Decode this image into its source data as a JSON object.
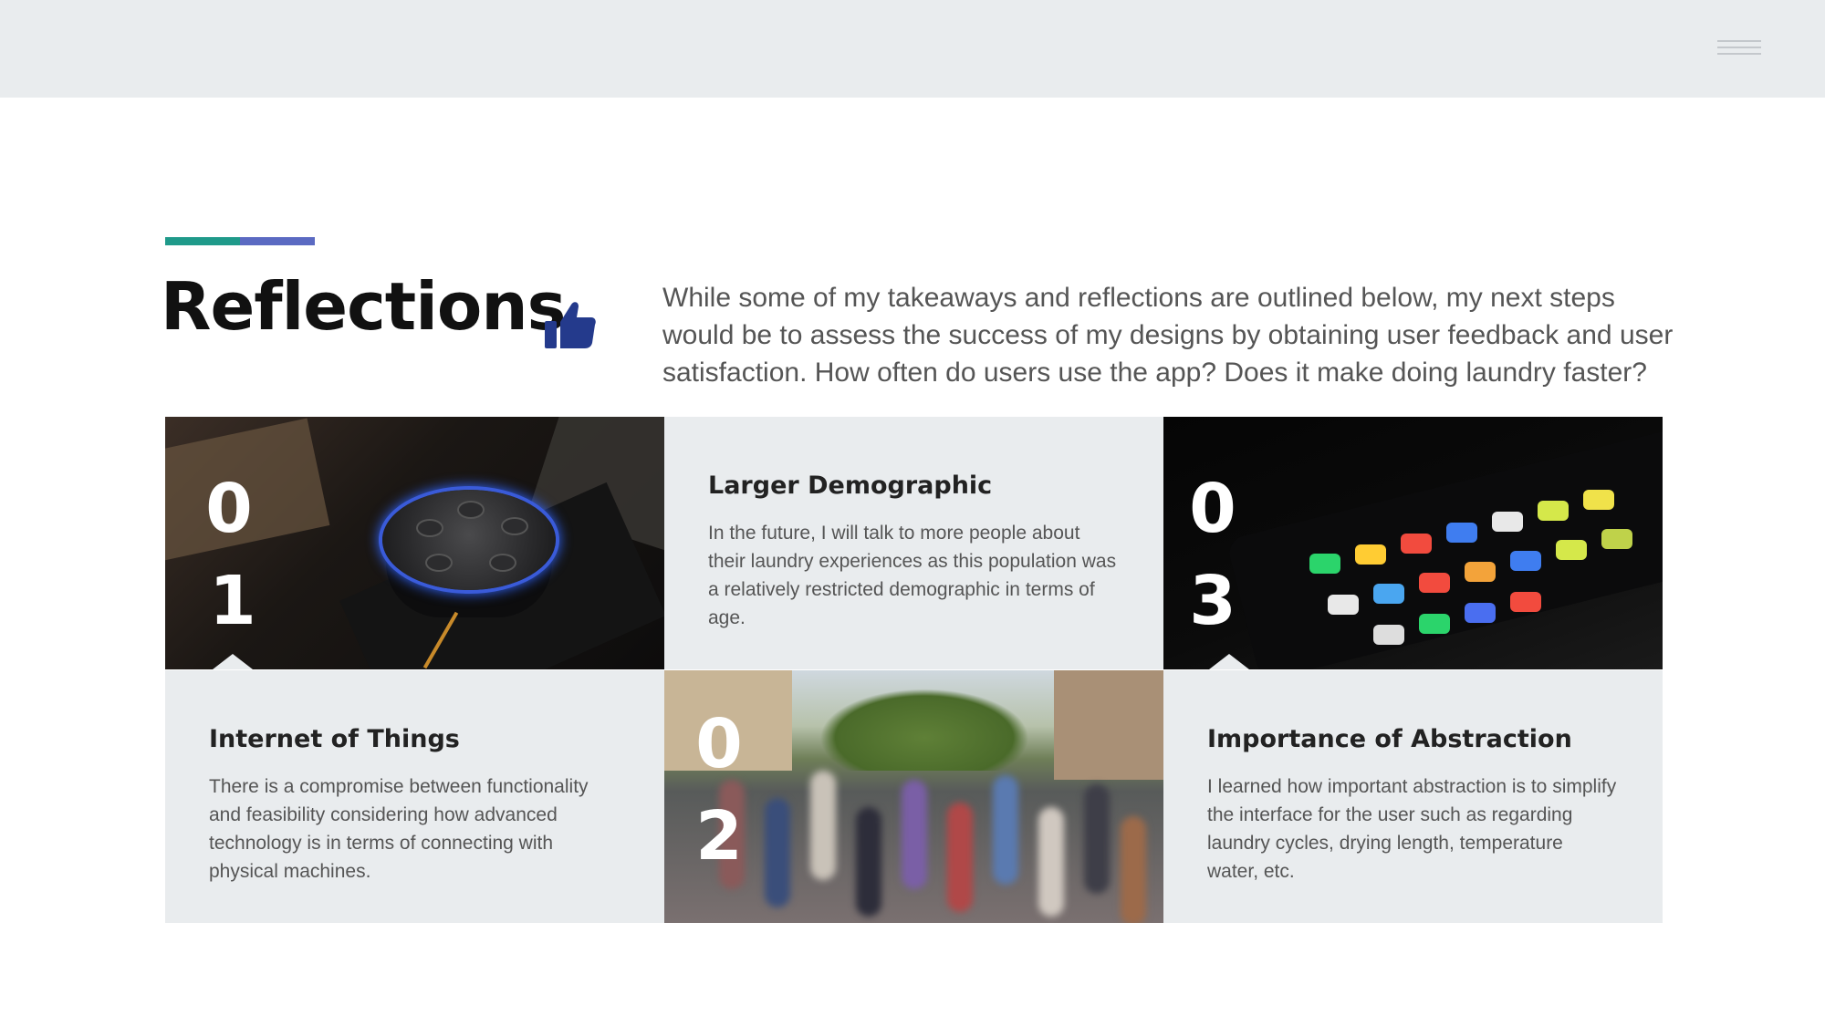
{
  "header": {
    "menu_icon": "hamburger-menu-icon"
  },
  "accent_colors": [
    "#1f9a8a",
    "#5b6ac2"
  ],
  "title": "Reflections",
  "title_icon": "thumbs-up-icon",
  "intro": "While some of my takeaways and reflections are outlined below, my next steps would be to assess the success of my designs by obtaining user feedback and user satisfaction. How often do users use the app? Does it make doing laundry faster?",
  "cards": [
    {
      "number_top": "0",
      "number_bottom": "1",
      "title": "Internet of Things",
      "text": "There is a compromise between functionality and feasibility considering how advanced technology is in terms of connecting with physical machines."
    },
    {
      "number_top": "0",
      "number_bottom": "2",
      "title": "Larger Demographic",
      "text": "In the future, I will talk to more people about their laundry experiences as this population was a relatively restricted demographic in terms of age."
    },
    {
      "number_top": "0",
      "number_bottom": "3",
      "title": "Importance of Abstraction",
      "text": "I learned how important abstraction is to simplify the interface for the user such as regarding laundry cycles, drying length, temperature water, etc."
    }
  ]
}
